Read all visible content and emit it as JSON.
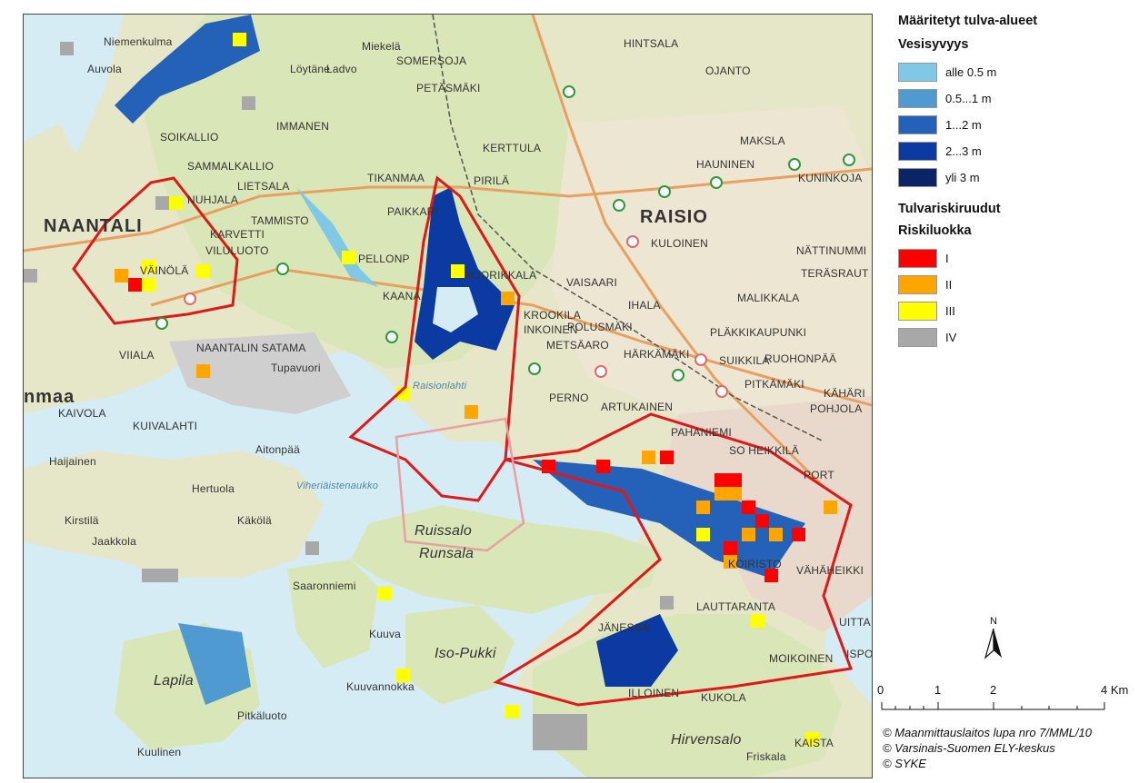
{
  "legend": {
    "title": "Määritetyt tulva-alueet",
    "depth_title": "Vesisyvyys",
    "depth_classes": [
      {
        "label": "alle 0.5 m",
        "color": "#7fc8e6"
      },
      {
        "label": "0.5...1 m",
        "color": "#4f9ad0"
      },
      {
        "label": "1...2 m",
        "color": "#2461b8"
      },
      {
        "label": "2...3 m",
        "color": "#0b3aa3"
      },
      {
        "label": "yli 3 m",
        "color": "#0a2466"
      }
    ],
    "risk_title": "Tulvariskiruudut",
    "risk_class_title": "Riskiluokka",
    "risk_classes": [
      {
        "label": "I",
        "color": "#ff0000"
      },
      {
        "label": "II",
        "color": "#ffa500"
      },
      {
        "label": "III",
        "color": "#ffff00"
      },
      {
        "label": "IV",
        "color": "#a8a8a8"
      }
    ]
  },
  "north_label": "N",
  "scale": {
    "labels": [
      "0",
      "1",
      "2",
      "4 Km"
    ]
  },
  "credits": [
    "© Maanmittauslaitos lupa nro 7/MML/10",
    "© Varsinais-Suomen ELY-keskus",
    "© SYKE"
  ],
  "places": [
    {
      "id": "naantali",
      "text": "NAANTALI",
      "cls": "big"
    },
    {
      "id": "raisio",
      "text": "RAISIO",
      "cls": "big"
    },
    {
      "id": "ruissalo",
      "text": "Ruissalo",
      "cls": "island"
    },
    {
      "id": "runsala",
      "text": "Runsala",
      "cls": "island"
    },
    {
      "id": "hirvensalo",
      "text": "Hirvensalo",
      "cls": "island"
    },
    {
      "id": "iso-pukki",
      "text": "Iso-Pukki",
      "cls": "island"
    },
    {
      "id": "lapila",
      "text": "Lapila",
      "cls": "island"
    },
    {
      "id": "niemenkulma",
      "text": "Niemenkulma",
      "cls": ""
    },
    {
      "id": "miekela",
      "text": "Miekelä",
      "cls": ""
    },
    {
      "id": "somersoja",
      "text": "SOMERSOJA",
      "cls": ""
    },
    {
      "id": "petasmaki",
      "text": "PETÄSMÄKI",
      "cls": ""
    },
    {
      "id": "kerttula",
      "text": "KERTTULA",
      "cls": ""
    },
    {
      "id": "tikanmaa",
      "text": "TIKANMAA",
      "cls": ""
    },
    {
      "id": "auvola",
      "text": "Auvola",
      "cls": ""
    },
    {
      "id": "soikallio",
      "text": "SOIKALLIO",
      "cls": ""
    },
    {
      "id": "sammalkallio",
      "text": "SAMMALKALLIO",
      "cls": ""
    },
    {
      "id": "nuhjala",
      "text": "NUHJALA",
      "cls": ""
    },
    {
      "id": "karvetti",
      "text": "KARVETTI",
      "cls": ""
    },
    {
      "id": "tammisto",
      "text": "TAMMISTO",
      "cls": ""
    },
    {
      "id": "vainola",
      "text": "VÄINÖLÄ",
      "cls": ""
    },
    {
      "id": "viiala",
      "text": "VIIALA",
      "cls": ""
    },
    {
      "id": "naantalin-satama",
      "text": "NAANTALIN SATAMA",
      "cls": ""
    },
    {
      "id": "kaivola",
      "text": "KAIVOLA",
      "cls": ""
    },
    {
      "id": "kuivalahti",
      "text": "KUIVALAHTI",
      "cls": ""
    },
    {
      "id": "haijainen",
      "text": "Haijainen",
      "cls": ""
    },
    {
      "id": "hauninen",
      "text": "HAUNINEN",
      "cls": ""
    },
    {
      "id": "maksla",
      "text": "MAKSLA",
      "cls": ""
    },
    {
      "id": "ojanto",
      "text": "OJANTO",
      "cls": ""
    },
    {
      "id": "kuninkoja",
      "text": "KUNINKOJA",
      "cls": ""
    },
    {
      "id": "kuloinen",
      "text": "KULOINEN",
      "cls": ""
    },
    {
      "id": "ihala",
      "text": "IHALA",
      "cls": ""
    },
    {
      "id": "vaisaari",
      "text": "VAISAARI",
      "cls": ""
    },
    {
      "id": "nuorikkala",
      "text": "NUORIKKALA",
      "cls": ""
    },
    {
      "id": "krookila",
      "text": "KROOKILA",
      "cls": ""
    },
    {
      "id": "inkoinen",
      "text": "INKOINEN",
      "cls": ""
    },
    {
      "id": "polusmaki",
      "text": "POLUSMÄKI",
      "cls": ""
    },
    {
      "id": "metsaaro",
      "text": "METSÄARO",
      "cls": ""
    },
    {
      "id": "harkamaki",
      "text": "HÄRKÄMÄKI",
      "cls": ""
    },
    {
      "id": "suikkila",
      "text": "SUIKKILA",
      "cls": ""
    },
    {
      "id": "ruohonpaa",
      "text": "RUOHONPÄÄ",
      "cls": ""
    },
    {
      "id": "pitkamaki",
      "text": "PITKÄMÄKI",
      "cls": ""
    },
    {
      "id": "malikkala",
      "text": "MALIKKALA",
      "cls": ""
    },
    {
      "id": "plakkikaupunki",
      "text": "PLÄKKIKAUPUNKI",
      "cls": ""
    },
    {
      "id": "nattinummi",
      "text": "NÄTTINUMMI",
      "cls": ""
    },
    {
      "id": "terasrauta",
      "text": "TERÄSRAUT",
      "cls": ""
    },
    {
      "id": "kahari",
      "text": "KÄHÄRI",
      "cls": ""
    },
    {
      "id": "pohjola",
      "text": "POHJOLA",
      "cls": ""
    },
    {
      "id": "perno",
      "text": "PERNO",
      "cls": ""
    },
    {
      "id": "artukainen",
      "text": "ARTUKAINEN",
      "cls": ""
    },
    {
      "id": "pahaniemi",
      "text": "PAHANIEMI",
      "cls": ""
    },
    {
      "id": "heikkila",
      "text": "SO HEIKKILÄ",
      "cls": ""
    },
    {
      "id": "vahaheikkila",
      "text": "VÄHÄHEIKKI",
      "cls": ""
    },
    {
      "id": "uittamo",
      "text": "UITTA",
      "cls": ""
    },
    {
      "id": "moikoinen",
      "text": "MOIKOINEN",
      "cls": ""
    },
    {
      "id": "lauttaranta",
      "text": "LAUTTARANTA",
      "cls": ""
    },
    {
      "id": "kukola",
      "text": "KUKOLA",
      "cls": ""
    },
    {
      "id": "friskala",
      "text": "Friskala",
      "cls": ""
    },
    {
      "id": "kaistarniemi",
      "text": "KAISTA",
      "cls": ""
    },
    {
      "id": "janessa",
      "text": "JÄNESSA",
      "cls": ""
    },
    {
      "id": "illoinen",
      "text": "ILLOINEN",
      "cls": ""
    },
    {
      "id": "saaronniemi",
      "text": "Saaronniemi",
      "cls": ""
    },
    {
      "id": "kuuva",
      "text": "Kuuva",
      "cls": ""
    },
    {
      "id": "kuuvannokka",
      "text": "Kuuvannokka",
      "cls": ""
    },
    {
      "id": "pitkaluoto",
      "text": "Pitkäluoto",
      "cls": ""
    },
    {
      "id": "kuulinen",
      "text": "Kuulinen",
      "cls": ""
    },
    {
      "id": "kakola",
      "text": "Käkölä",
      "cls": ""
    },
    {
      "id": "kirstila",
      "text": "Kirstilä",
      "cls": ""
    },
    {
      "id": "jaakkola",
      "text": "Jaakkola",
      "cls": ""
    },
    {
      "id": "hertuola",
      "text": "Hertuola",
      "cls": ""
    },
    {
      "id": "aitonpaa",
      "text": "Aitonpää",
      "cls": ""
    },
    {
      "id": "viheriaistenaukko",
      "text": "Viheriäistenaukko",
      "cls": "water"
    },
    {
      "id": "raisionlahti",
      "text": "Raisionlahti",
      "cls": "water"
    },
    {
      "id": "ammaa",
      "text": "nmaa",
      "cls": "big"
    },
    {
      "id": "tupavuori",
      "text": "Tupavuori",
      "cls": ""
    },
    {
      "id": "lietsala",
      "text": "LIETSALA",
      "cls": ""
    },
    {
      "id": "loytane",
      "text": "Löytäne",
      "cls": ""
    },
    {
      "id": "ladvo",
      "text": "Ladvo",
      "cls": ""
    },
    {
      "id": "immanen",
      "text": "IMMANEN",
      "cls": ""
    },
    {
      "id": "pirila",
      "text": "PIRILÄ",
      "cls": ""
    },
    {
      "id": "paikkari",
      "text": "PAIKKARI",
      "cls": ""
    },
    {
      "id": "pellonpaa",
      "text": "PELLONP",
      "cls": ""
    },
    {
      "id": "kaanaa",
      "text": "KAANA",
      "cls": ""
    },
    {
      "id": "viluluoto",
      "text": "VILULUOTO",
      "cls": ""
    },
    {
      "id": "port",
      "text": "PORT",
      "cls": ""
    },
    {
      "id": "koristo",
      "text": "KOIRISTO",
      "cls": ""
    },
    {
      "id": "ispoinen",
      "text": "ISPO",
      "cls": ""
    },
    {
      "id": "hintsala",
      "text": "HINTSALA",
      "cls": ""
    }
  ]
}
